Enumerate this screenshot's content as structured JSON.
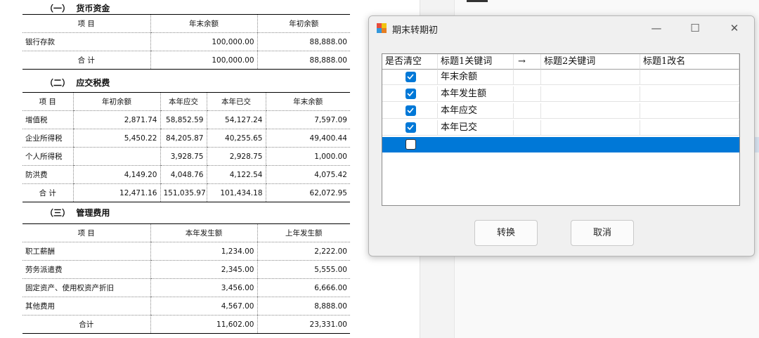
{
  "dialog": {
    "title": "期末转期初",
    "min_glyph": "—",
    "max_glyph": "☐",
    "close_glyph": "✕",
    "columns": [
      "是否清空",
      "标题1关键词",
      "→",
      "标题2关键词",
      "标题1改名"
    ],
    "rows": [
      {
        "checked": true,
        "kw1": "年末余额",
        "kw2": "",
        "rename": ""
      },
      {
        "checked": true,
        "kw1": "本年发生额",
        "kw2": "",
        "rename": ""
      },
      {
        "checked": true,
        "kw1": "本年应交",
        "kw2": "",
        "rename": ""
      },
      {
        "checked": true,
        "kw1": "本年已交",
        "kw2": "",
        "rename": ""
      },
      {
        "checked": false,
        "kw1": "",
        "kw2": "",
        "rename": ""
      }
    ],
    "convert_label": "转换",
    "cancel_label": "取消",
    "selected_row_color": "#0078d7"
  },
  "doc": {
    "cash": {
      "title": "（一）  货币资金",
      "headers": [
        "项    目",
        "年末余额",
        "年初余额"
      ],
      "rows": [
        {
          "name": "银行存款",
          "end": "100,000.00",
          "begin": "88,888.00"
        },
        {
          "name": "合  计",
          "end": "100,000.00",
          "begin": "88,888.00"
        }
      ]
    },
    "tax": {
      "title": "（二）  应交税费",
      "headers": [
        "项    目",
        "年初余额",
        "本年应交",
        "本年已交",
        "年末余额"
      ],
      "rows": [
        {
          "name": "增值税",
          "begin": "2,871.74",
          "due": "58,852.59",
          "paid": "54,127.24",
          "end": "7,597.09"
        },
        {
          "name": "企业所得税",
          "begin": "5,450.22",
          "due": "84,205.87",
          "paid": "40,255.65",
          "end": "49,400.44"
        },
        {
          "name": "个人所得税",
          "begin": "",
          "due": "3,928.75",
          "paid": "2,928.75",
          "end": "1,000.00"
        },
        {
          "name": "防洪费",
          "begin": "4,149.20",
          "due": "4,048.76",
          "paid": "4,122.54",
          "end": "4,075.42"
        },
        {
          "name": "合  计",
          "begin": "12,471.16",
          "due": "151,035.97",
          "paid": "101,434.18",
          "end": "62,072.95"
        }
      ]
    },
    "mgmt": {
      "title": "（三）  管理费用",
      "headers": [
        "项    目",
        "本年发生额",
        "上年发生额"
      ],
      "rows": [
        {
          "name": "职工薪酬",
          "cur": "1,234.00",
          "prev": "2,222.00"
        },
        {
          "name": "劳务派遣费",
          "cur": "2,345.00",
          "prev": "5,555.00"
        },
        {
          "name": "固定资产、使用权资产折旧",
          "cur": "3,456.00",
          "prev": "6,666.00"
        },
        {
          "name": "其他费用",
          "cur": "4,567.00",
          "prev": "8,888.00"
        },
        {
          "name": "合计",
          "cur": "11,602.00",
          "prev": "23,331.00"
        }
      ]
    }
  }
}
